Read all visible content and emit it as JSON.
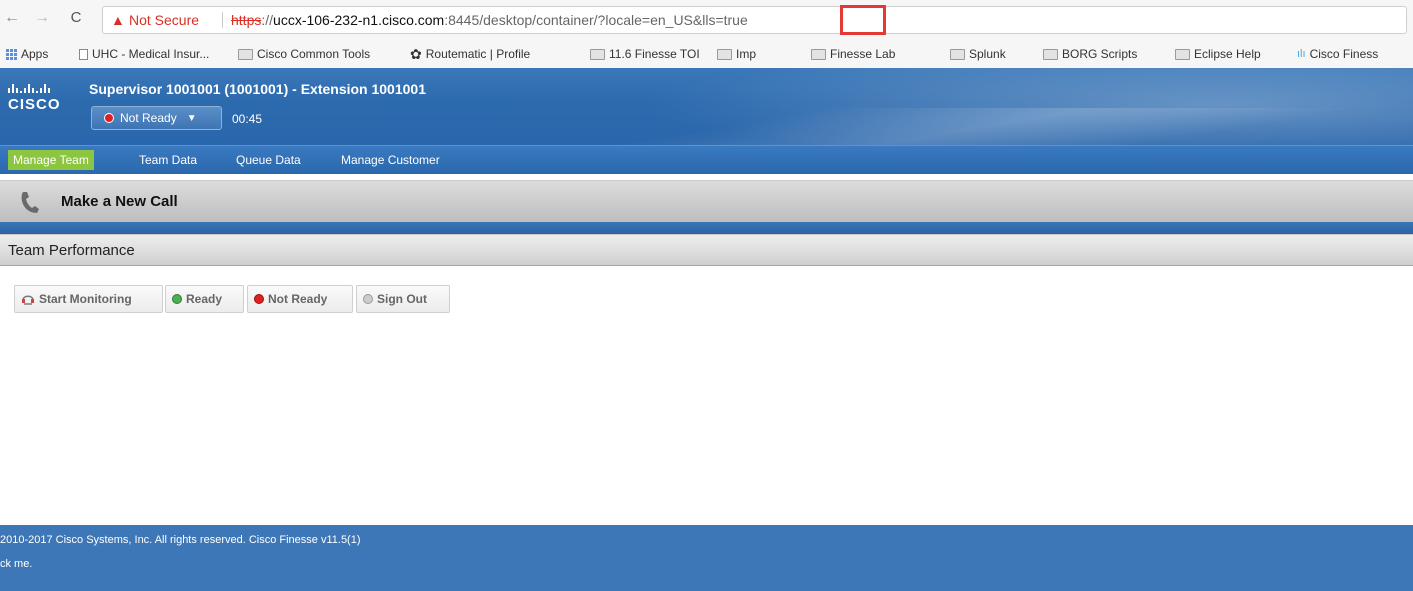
{
  "browser": {
    "nav_back": "←",
    "nav_forward": "→",
    "nav_reload": "C",
    "warning_icon": "▲",
    "not_secure": "Not Secure",
    "url_scheme": "https",
    "url_host": "uccx-106-232-n1.cisco.com",
    "url_rest": ":8445/desktop/container/?locale=en_US&lls=true",
    "highlight_color": "#e53935"
  },
  "bookmarks": {
    "items": [
      {
        "label": "Apps",
        "icon": "apps-grid-icon"
      },
      {
        "label": "UHC - Medical Insur...",
        "icon": "page-icon"
      },
      {
        "label": "Cisco Common Tools",
        "icon": "folder-icon"
      },
      {
        "label": "Routematic | Profile",
        "icon": "gear-icon"
      },
      {
        "label": "11.6 Finesse TOI",
        "icon": "folder-icon"
      },
      {
        "label": "Imp",
        "icon": "folder-icon"
      },
      {
        "label": "Finesse Lab",
        "icon": "folder-icon"
      },
      {
        "label": "Splunk",
        "icon": "folder-icon"
      },
      {
        "label": "BORG Scripts",
        "icon": "folder-icon"
      },
      {
        "label": "Eclipse Help",
        "icon": "folder-icon"
      },
      {
        "label": "Cisco Finess",
        "icon": "cisco-icon"
      }
    ]
  },
  "header": {
    "logo_text": "CISCO",
    "title": "Supervisor 1001001 (1001001) - Extension 1001001",
    "state_label": "Not Ready",
    "state_color": "#e02020",
    "timer": "00:45"
  },
  "tabs": [
    {
      "label": "Manage Team",
      "active": true
    },
    {
      "label": "Team Data",
      "active": false
    },
    {
      "label": "Queue Data",
      "active": false
    },
    {
      "label": "Manage Customer",
      "active": false
    }
  ],
  "call": {
    "label": "Make a New Call",
    "icon": "phone-handset-icon"
  },
  "team_performance": {
    "title": "Team Performance",
    "buttons": {
      "start_monitoring": "Start Monitoring",
      "ready": "Ready",
      "not_ready": "Not Ready",
      "sign_out": "Sign Out"
    },
    "colors": {
      "ready": "#4caf50",
      "not_ready": "#e02020",
      "sign_out": "#aaaaaa"
    }
  },
  "footer": {
    "copyright": "2010-2017 Cisco Systems, Inc. All rights reserved. Cisco Finesse v11.5(1)",
    "click_me": "ck me."
  }
}
